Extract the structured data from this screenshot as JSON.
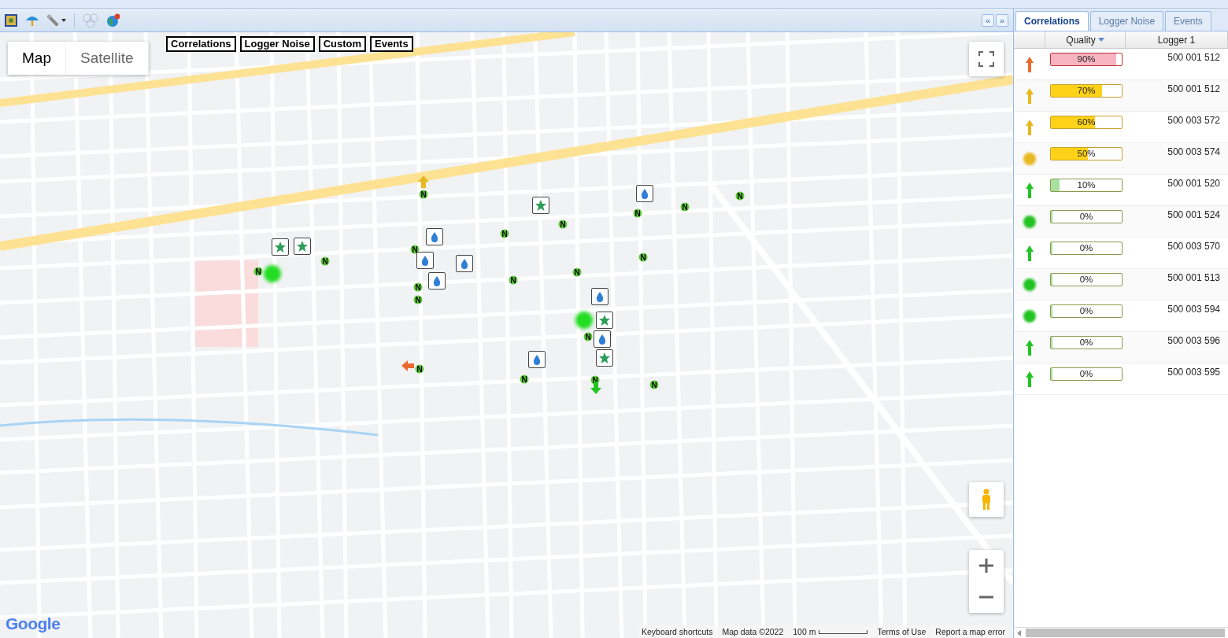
{
  "toolbar": {
    "tools": [
      {
        "kind": "region"
      },
      {
        "kind": "umbrella"
      },
      {
        "kind": "wrench",
        "dropdown": true
      },
      {
        "kind": "bubbles",
        "disabled": true
      },
      {
        "kind": "globe"
      }
    ]
  },
  "map": {
    "types": [
      {
        "label": "Map",
        "selected": true
      },
      {
        "label": "Satellite",
        "selected": false
      }
    ],
    "layers": [
      "Correlations",
      "Logger Noise",
      "Custom",
      "Events"
    ],
    "markers": [
      {
        "kind": "node",
        "label": "N"
      },
      {
        "kind": "node",
        "label": "N"
      },
      {
        "kind": "node",
        "label": "N"
      },
      {
        "kind": "node",
        "label": "N"
      },
      {
        "kind": "node",
        "label": "N"
      },
      {
        "kind": "node",
        "label": "N"
      },
      {
        "kind": "node",
        "label": "N"
      },
      {
        "kind": "node",
        "label": "N"
      },
      {
        "kind": "node",
        "label": "N"
      },
      {
        "kind": "node",
        "label": "N"
      },
      {
        "kind": "node",
        "label": "N"
      },
      {
        "kind": "node",
        "label": "N"
      },
      {
        "kind": "node",
        "label": "N"
      },
      {
        "kind": "node",
        "label": "N"
      },
      {
        "kind": "node",
        "label": "N"
      },
      {
        "kind": "node",
        "label": "N"
      },
      {
        "kind": "node",
        "label": "N"
      },
      {
        "kind": "node",
        "label": "N"
      },
      {
        "kind": "node",
        "label": "N"
      },
      {
        "kind": "drop"
      },
      {
        "kind": "drop"
      },
      {
        "kind": "drop"
      },
      {
        "kind": "drop"
      },
      {
        "kind": "drop"
      },
      {
        "kind": "drop"
      },
      {
        "kind": "drop"
      },
      {
        "kind": "drop"
      },
      {
        "kind": "star"
      },
      {
        "kind": "star"
      },
      {
        "kind": "star"
      },
      {
        "kind": "star"
      },
      {
        "kind": "star"
      },
      {
        "kind": "arrow",
        "color": "#e8b820"
      },
      {
        "kind": "arrow",
        "color": "#e86a30"
      },
      {
        "kind": "arrow",
        "color": "#22c322"
      },
      {
        "kind": "glow",
        "color": "#22dd22"
      },
      {
        "kind": "glow",
        "color": "#22dd22"
      }
    ],
    "logo": "Google",
    "footer": [
      "Keyboard shortcuts",
      "Map data ©2022"
    ],
    "scale": "100 m",
    "footer_links": [
      "Terms of Use",
      "Report a map error"
    ]
  },
  "panel": {
    "toggles": [
      "«",
      "»"
    ],
    "tabs": [
      {
        "label": "Correlations",
        "selected": true
      },
      {
        "label": "Logger Noise",
        "selected": false
      },
      {
        "label": "Events",
        "selected": false
      }
    ],
    "columns": [
      "Quality",
      "Logger 1"
    ],
    "rows": [
      {
        "kind": "arrow",
        "color": "#e86a30",
        "level": 0.9,
        "quality": "90%",
        "logger": "500 001 512"
      },
      {
        "kind": "arrow",
        "color": "#e8b820",
        "level": 0.7,
        "quality": "70%",
        "logger": "500 001 512"
      },
      {
        "kind": "arrow",
        "color": "#e8b820",
        "level": 0.6,
        "quality": "60%",
        "logger": "500 003 572"
      },
      {
        "kind": "glow",
        "color": "#e8b820",
        "level": 0.5,
        "quality": "50%",
        "logger": "500 003 574"
      },
      {
        "kind": "arrow",
        "color": "#22c322",
        "level": 0.1,
        "quality": "10%",
        "logger": "500 001 520"
      },
      {
        "kind": "glow",
        "color": "#22c322",
        "level": 0,
        "quality": "0%",
        "logger": "500 001 524"
      },
      {
        "kind": "arrow",
        "color": "#22c322",
        "level": 0,
        "quality": "0%",
        "logger": "500 003 570"
      },
      {
        "kind": "glow",
        "color": "#22c322",
        "level": 0,
        "quality": "0%",
        "logger": "500 001 513"
      },
      {
        "kind": "glow",
        "color": "#22c322",
        "level": 0,
        "quality": "0%",
        "logger": "500 003 594"
      },
      {
        "kind": "arrow",
        "color": "#22c322",
        "level": 0,
        "quality": "0%",
        "logger": "500 003 596"
      },
      {
        "kind": "arrow",
        "color": "#22c322",
        "level": 0,
        "quality": "0%",
        "logger": "500 003 595"
      }
    ]
  }
}
